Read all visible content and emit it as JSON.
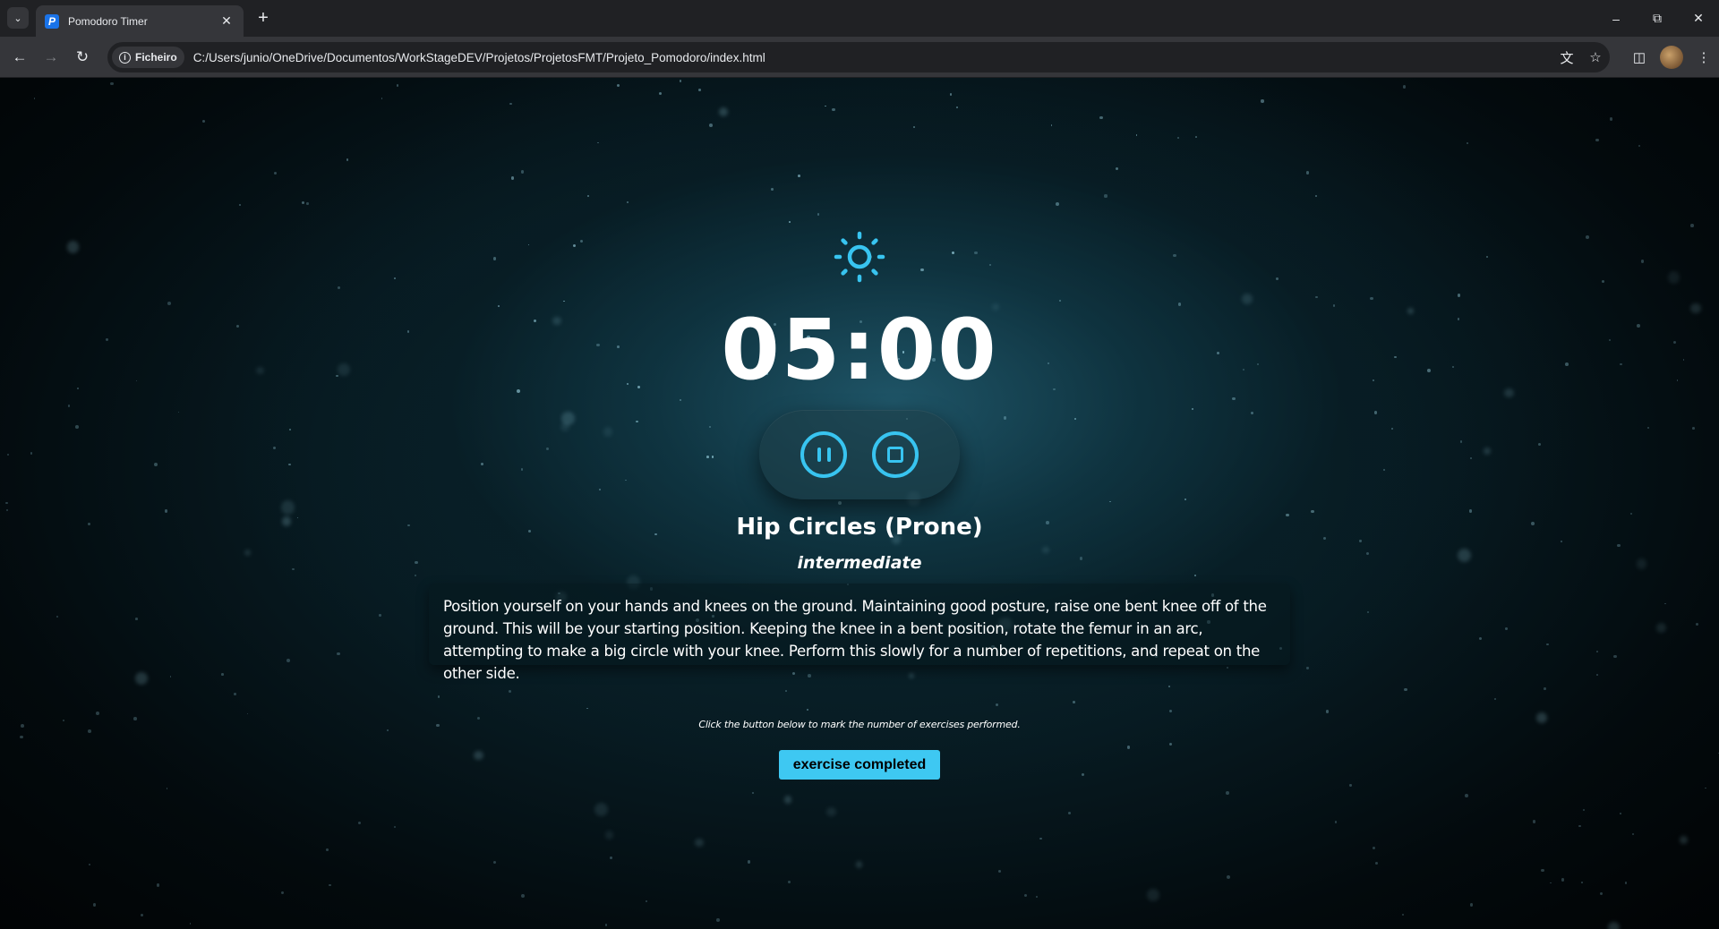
{
  "browser": {
    "tab_title": "Pomodoro Timer",
    "tab_favicon_letter": "P",
    "site_chip_label": "Ficheiro",
    "url": "C:/Users/junio/OneDrive/Documentos/WorkStageDEV/Projetos/ProjetosFMT/Projeto_Pomodoro/index.html"
  },
  "timer": {
    "mode_icon": "sun-icon",
    "time": "05:00"
  },
  "exercise": {
    "name": "Hip Circles (Prone)",
    "level": "intermediate",
    "description": "Position yourself on your hands and knees on the ground. Maintaining good posture, raise one bent knee off of the ground. This will be your starting position. Keeping the knee in a bent position, rotate the femur in an arc, attempting to make a big circle with your knee. Perform this slowly for a number of repetitions, and repeat on the other side."
  },
  "hint": "Click the button below to mark the number of exercises performed.",
  "complete_button_label": "exercise completed",
  "colors": {
    "accent": "#3ec8f2",
    "background": "#0c2c36"
  }
}
